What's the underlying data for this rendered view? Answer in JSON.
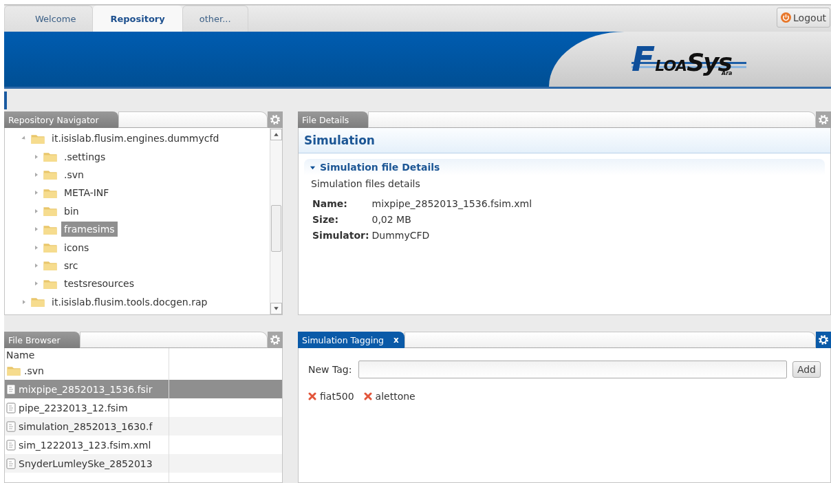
{
  "top_tabs": [
    {
      "label": "Welcome",
      "selected": false
    },
    {
      "label": "Repository",
      "selected": true
    },
    {
      "label": "other...",
      "selected": false
    }
  ],
  "logout_button": "Logout",
  "logo": {
    "initial": "F",
    "letters": "LOA",
    "mark": "Sys",
    "sub": "Ara"
  },
  "repository_navigator": {
    "title": "Repository Navigator",
    "active": false,
    "tree": [
      {
        "label": "it.isislab.flusim.engines.dummycfd",
        "expanded": true,
        "selected": false,
        "children": [
          {
            "label": ".settings",
            "expanded": false,
            "selected": false
          },
          {
            "label": ".svn",
            "expanded": false,
            "selected": false
          },
          {
            "label": "META-INF",
            "expanded": false,
            "selected": false
          },
          {
            "label": "bin",
            "expanded": false,
            "selected": false
          },
          {
            "label": "framesims",
            "expanded": false,
            "selected": true
          },
          {
            "label": "icons",
            "expanded": false,
            "selected": false
          },
          {
            "label": "src",
            "expanded": false,
            "selected": false
          },
          {
            "label": "testsresources",
            "expanded": false,
            "selected": false
          }
        ]
      },
      {
        "label": "it.isislab.flusim.tools.docgen.rap",
        "expanded": false,
        "selected": false
      }
    ]
  },
  "file_details": {
    "title": "File Details",
    "active": false,
    "heading": "Simulation",
    "section": {
      "title": "Simulation file Details",
      "expanded": true,
      "description": "Simulation files details",
      "fields": [
        {
          "label": "Name:",
          "value": "mixpipe_2852013_1536.fsim.xml"
        },
        {
          "label": "Size:",
          "value": "0,02 MB"
        },
        {
          "label": "Simulator:",
          "value": "DummyCFD"
        }
      ]
    }
  },
  "file_browser": {
    "title": "File Browser",
    "active": false,
    "columns": [
      "Name"
    ],
    "rows": [
      {
        "name": ".svn",
        "kind": "folder",
        "selected": false
      },
      {
        "name": "mixpipe_2852013_1536.fsir",
        "kind": "file",
        "selected": true
      },
      {
        "name": "pipe_2232013_12.fsim",
        "kind": "file",
        "selected": false
      },
      {
        "name": "simulation_2852013_1630.f",
        "kind": "file",
        "selected": false
      },
      {
        "name": "sim_1222013_123.fsim.xml",
        "kind": "file",
        "selected": false
      },
      {
        "name": "SnyderLumleySke_2852013",
        "kind": "file",
        "selected": false
      }
    ]
  },
  "simulation_tagging": {
    "title": "Simulation Tagging",
    "active": true,
    "close": "x",
    "new_tag_label": "New Tag:",
    "add_button": "Add",
    "tags": [
      "fiat500",
      "alettone"
    ]
  }
}
